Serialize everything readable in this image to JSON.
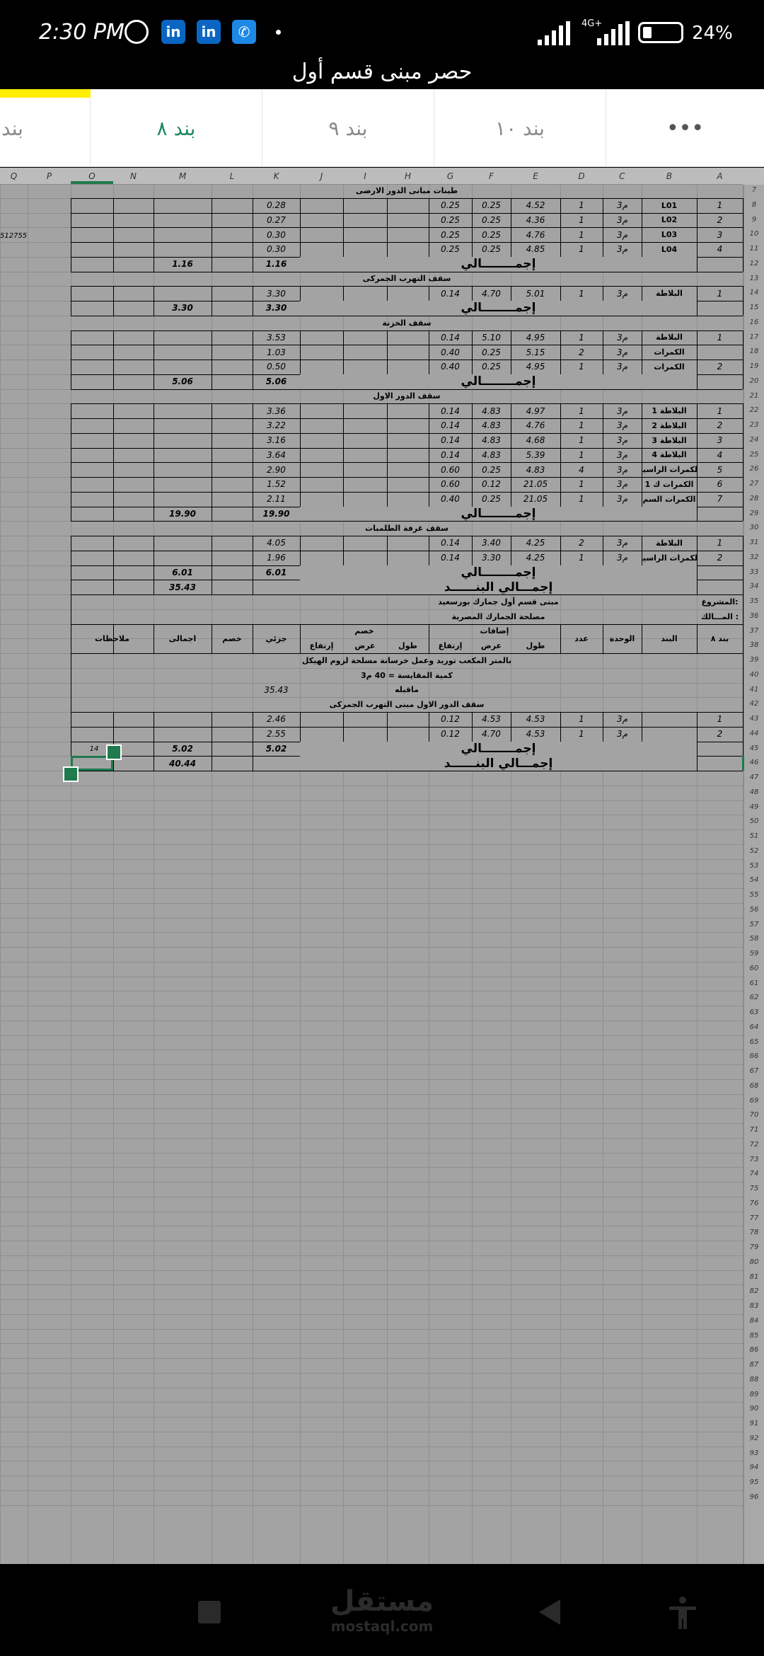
{
  "status": {
    "time": "2:30 PM",
    "battery": "24%",
    "network": "4G+"
  },
  "title": "حصر مبنى قسم أول",
  "tabs": [
    {
      "label": "بند",
      "active": false
    },
    {
      "label": "بند ٨",
      "active": true
    },
    {
      "label": "بند ٩",
      "active": false
    },
    {
      "label": "بند ١٠",
      "active": false
    }
  ],
  "more_label": "•••",
  "columns": [
    "Q",
    "P",
    "O",
    "N",
    "M",
    "L",
    "K",
    "J",
    "I",
    "H",
    "G",
    "F",
    "E",
    "D",
    "C",
    "B",
    "A"
  ],
  "row_numbers": [
    "7",
    "8",
    "9",
    "10",
    "11",
    "12",
    "13",
    "14",
    "15",
    "16",
    "17",
    "18",
    "19",
    "20",
    "21",
    "22",
    "23",
    "24",
    "25",
    "26",
    "27",
    "28",
    "29",
    "30",
    "31",
    "32",
    "33",
    "34",
    "35",
    "36",
    "37",
    "38",
    "39",
    "40",
    "41",
    "42",
    "43",
    "44",
    "45",
    "46",
    "47",
    "48",
    "49",
    "50",
    "51",
    "52",
    "53",
    "54",
    "55",
    "56",
    "57",
    "58",
    "59",
    "60",
    "61",
    "62",
    "63",
    "64",
    "65",
    "66",
    "67",
    "68",
    "69",
    "70",
    "71",
    "72",
    "73",
    "74",
    "75",
    "76",
    "77",
    "78",
    "79",
    "80",
    "81",
    "82",
    "83",
    "84",
    "85",
    "86",
    "87",
    "88",
    "89",
    "90",
    "91",
    "92",
    "93",
    "94",
    "95",
    "96"
  ],
  "side_value": "512755",
  "cell_hint": "14",
  "header_block": {
    "project_label": "المشروع:",
    "owner_label": "المـــالك :",
    "project": "مبنى قسم أول جمارك بورسعيد",
    "owner": "مصلحة الجمارك المصرية",
    "item_no": "بند ٨",
    "item": "البند",
    "unit": "الوحدة",
    "count": "عدد",
    "additions": "إضافات",
    "length": "طول",
    "width": "عرض",
    "height": "إرتفاع",
    "deduction": "خصم",
    "partial": "جزئي",
    "ded_total": "خصم",
    "total": "اجمالى",
    "notes": "ملاحظات",
    "desc": "بالمتر المكعب توريد وعمل خرسانة مسلحة لزوم الهيكل",
    "qty": "كمية المقايسة = 40 م3",
    "prev_label": "ماقبله",
    "prev_value": "35.43",
    "section": "سقف الدور الاول مبنى التهرب الجمركى"
  },
  "sections": [
    {
      "title": "طبنات مبانى الدور الارضى",
      "rows": [
        {
          "n": "1",
          "b": "L01",
          "u": "م3",
          "cnt": "1",
          "l": "4.52",
          "w": "0.25",
          "h": "0.25",
          "part": "0.28"
        },
        {
          "n": "2",
          "b": "L02",
          "u": "م3",
          "cnt": "1",
          "l": "4.36",
          "w": "0.25",
          "h": "0.25",
          "part": "0.27"
        },
        {
          "n": "3",
          "b": "L03",
          "u": "م3",
          "cnt": "1",
          "l": "4.76",
          "w": "0.25",
          "h": "0.25",
          "part": "0.30"
        },
        {
          "n": "4",
          "b": "L04",
          "u": "م3",
          "cnt": "1",
          "l": "4.85",
          "w": "0.25",
          "h": "0.25",
          "part": "0.30"
        }
      ],
      "total": "1.16"
    },
    {
      "title": "سقف التهرب الجمركى",
      "rows": [
        {
          "n": "1",
          "b": "البلاطة",
          "u": "م3",
          "cnt": "1",
          "l": "5.01",
          "w": "4.70",
          "h": "0.14",
          "part": "3.30"
        }
      ],
      "total": "3.30"
    },
    {
      "title": "سقف الخزنة",
      "rows": [
        {
          "n": "1",
          "b": "البلاطة",
          "u": "م3",
          "cnt": "1",
          "l": "4.95",
          "w": "5.10",
          "h": "0.14",
          "part": "3.53"
        },
        {
          "n": "",
          "b": "الكمرات",
          "u": "م3",
          "cnt": "2",
          "l": "5.15",
          "w": "0.25",
          "h": "0.40",
          "part": "1.03"
        },
        {
          "n": "2",
          "b": "الكمرات",
          "u": "م3",
          "cnt": "1",
          "l": "4.95",
          "w": "0.25",
          "h": "0.40",
          "part": "0.50"
        }
      ],
      "total": "5.06"
    },
    {
      "title": "سقف الدور الاول",
      "rows": [
        {
          "n": "1",
          "b": "البلاطة 1",
          "u": "م3",
          "cnt": "1",
          "l": "4.97",
          "w": "4.83",
          "h": "0.14",
          "part": "3.36"
        },
        {
          "n": "2",
          "b": "البلاطة 2",
          "u": "م3",
          "cnt": "1",
          "l": "4.76",
          "w": "4.83",
          "h": "0.14",
          "part": "3.22"
        },
        {
          "n": "3",
          "b": "البلاطة 3",
          "u": "م3",
          "cnt": "1",
          "l": "4.68",
          "w": "4.83",
          "h": "0.14",
          "part": "3.16"
        },
        {
          "n": "4",
          "b": "البلاطة 4",
          "u": "م3",
          "cnt": "1",
          "l": "5.39",
          "w": "4.83",
          "h": "0.14",
          "part": "3.64"
        },
        {
          "n": "5",
          "b": "الكمرات الراسية",
          "u": "م3",
          "cnt": "4",
          "l": "4.83",
          "w": "0.25",
          "h": "0.60",
          "part": "2.90"
        },
        {
          "n": "6",
          "b": "الكمرات ك 1",
          "u": "م3",
          "cnt": "1",
          "l": "21.05",
          "w": "0.12",
          "h": "0.60",
          "part": "1.52"
        },
        {
          "n": "7",
          "b": "الكمرات السم",
          "u": "م3",
          "cnt": "1",
          "l": "21.05",
          "w": "0.25",
          "h": "0.40",
          "part": "2.11"
        }
      ],
      "total": "19.90"
    },
    {
      "title": "سقف غرفة الطلمبات",
      "rows": [
        {
          "n": "1",
          "b": "البلاطة",
          "u": "م3",
          "cnt": "2",
          "l": "4.25",
          "w": "3.40",
          "h": "0.14",
          "part": "4.05"
        },
        {
          "n": "2",
          "b": "الكمرات الراسية",
          "u": "م3",
          "cnt": "1",
          "l": "4.25",
          "w": "3.30",
          "h": "0.14",
          "part": "1.96"
        }
      ],
      "total": "6.01"
    }
  ],
  "total_label": "إجمــــــــالي",
  "item_total_label": "إجمـــالي البنــــــد",
  "item_total": "35.43",
  "second_rows": [
    {
      "n": "1",
      "b": "",
      "u": "م3",
      "cnt": "1",
      "l": "4.53",
      "w": "4.53",
      "h": "0.12",
      "part": "2.46"
    },
    {
      "n": "2",
      "b": "",
      "u": "م3",
      "cnt": "1",
      "l": "4.53",
      "w": "4.70",
      "h": "0.12",
      "part": "2.55"
    }
  ],
  "second_total": "5.02",
  "grand_total": "40.44",
  "watermark": {
    "arabic": "مستقل",
    "latin": "mostaql.com"
  }
}
